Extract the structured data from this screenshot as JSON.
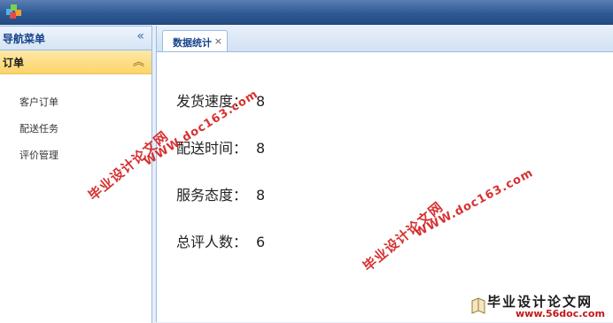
{
  "sidebar": {
    "title": "导航菜单",
    "collapse_icon": "double-chevron-left-icon",
    "group": {
      "title": "订单",
      "toggle_icon": "double-chevron-up-icon",
      "items": [
        {
          "label": "客户订单"
        },
        {
          "label": "配送任务"
        },
        {
          "label": "评价管理"
        }
      ]
    }
  },
  "tabs": [
    {
      "label": "数据统计",
      "close": "×"
    }
  ],
  "stats": [
    {
      "label": "发货速度",
      "sep": "：",
      "value": "8"
    },
    {
      "label": "配送时间",
      "sep": "：",
      "value": "8"
    },
    {
      "label": "服务态度",
      "sep": "：",
      "value": "8"
    },
    {
      "label": "总评人数",
      "sep": "：",
      "value": "6"
    }
  ],
  "watermark": {
    "cn": "毕业设计论文网",
    "url": "WWW.doc163.com",
    "brand": "毕业设计论文网",
    "brand_url": "www.56doc.com"
  },
  "colors": {
    "topbar": "#2e5a95",
    "accent": "#15428b",
    "group_header": "#fbd469",
    "watermark": "#d42020"
  }
}
